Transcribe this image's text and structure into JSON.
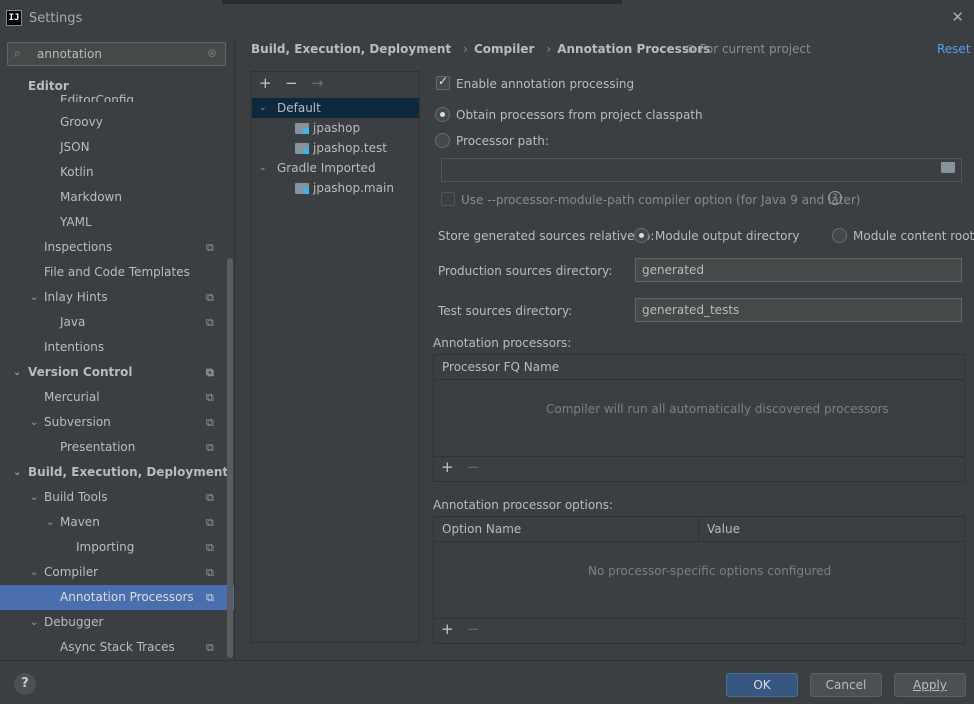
{
  "window": {
    "title": "Settings",
    "logo_text": "IJ"
  },
  "search": {
    "value": "annotation"
  },
  "sidebar": {
    "items": [
      {
        "label": "Editor",
        "bold": true
      },
      {
        "label": "EditorConfig"
      },
      {
        "label": "Groovy"
      },
      {
        "label": "JSON"
      },
      {
        "label": "Kotlin"
      },
      {
        "label": "Markdown"
      },
      {
        "label": "YAML"
      },
      {
        "label": "Inspections"
      },
      {
        "label": "File and Code Templates"
      },
      {
        "label": "Inlay Hints"
      },
      {
        "label": "Java"
      },
      {
        "label": "Intentions"
      },
      {
        "label": "Version Control",
        "bold": true
      },
      {
        "label": "Mercurial"
      },
      {
        "label": "Subversion"
      },
      {
        "label": "Presentation"
      },
      {
        "label": "Build, Execution, Deployment",
        "bold": true
      },
      {
        "label": "Build Tools"
      },
      {
        "label": "Maven"
      },
      {
        "label": "Importing"
      },
      {
        "label": "Compiler"
      },
      {
        "label": "Annotation Processors",
        "selected": true
      },
      {
        "label": "Debugger"
      },
      {
        "label": "Async Stack Traces"
      }
    ]
  },
  "breadcrumb": [
    "Build, Execution, Deployment",
    "Compiler",
    "Annotation Processors"
  ],
  "header": {
    "for_project": "For current project",
    "reset": "Reset"
  },
  "profiles": {
    "toolbar": {
      "add": "+",
      "remove": "−",
      "move": "→"
    },
    "tree": [
      {
        "label": "Default",
        "selected": true
      },
      {
        "label": "jpashop"
      },
      {
        "label": "jpashop.test"
      },
      {
        "label": "Gradle Imported"
      },
      {
        "label": "jpashop.main"
      }
    ]
  },
  "settings": {
    "enable_processing": "Enable annotation processing",
    "obtain_from_classpath": "Obtain processors from project classpath",
    "processor_path": "Processor path:",
    "processor_path_value": "",
    "module_path_option": "Use --processor-module-path compiler option (for Java 9 and later)",
    "store_relative_to": "Store generated sources relative to:",
    "module_output": "Module output directory",
    "module_content_root": "Module content root",
    "production_dir_label": "Production sources directory:",
    "production_dir_value": "generated",
    "test_dir_label": "Test sources directory:",
    "test_dir_value": "generated_tests"
  },
  "processors_table": {
    "title": "Annotation processors:",
    "column": "Processor FQ Name",
    "empty": "Compiler will run all automatically discovered processors",
    "add": "+",
    "remove": "−"
  },
  "options_table": {
    "title": "Annotation processor options:",
    "col_name": "Option Name",
    "col_value": "Value",
    "empty": "No processor-specific options configured",
    "add": "+",
    "remove": "−"
  },
  "buttons": {
    "help": "?",
    "ok": "OK",
    "cancel": "Cancel",
    "apply": "Apply"
  },
  "colors": {
    "selection": "#4b6eaf",
    "primary_button": "#365880",
    "link": "#589df6"
  }
}
